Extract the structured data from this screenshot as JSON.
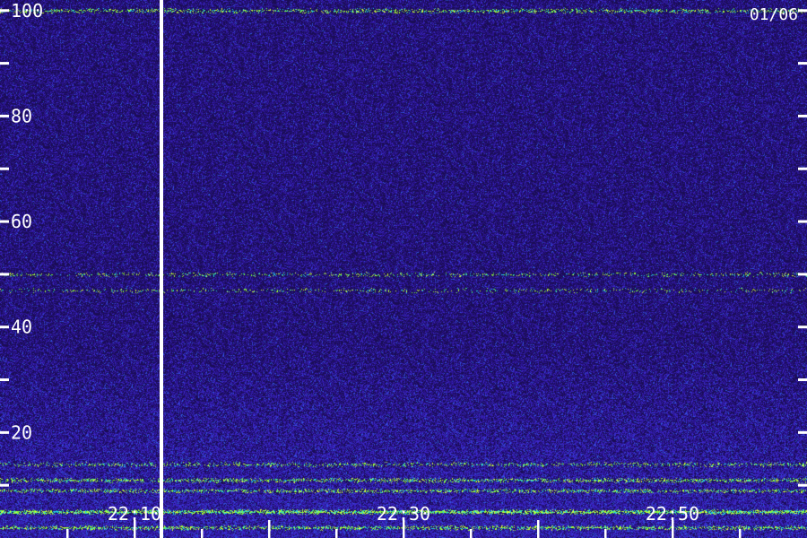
{
  "chart_data": {
    "type": "heatmap",
    "date_label": "01/06",
    "y_ticks": [
      100,
      80,
      60,
      40,
      20
    ],
    "y_minor_ticks": [
      90,
      70,
      50,
      30,
      10
    ],
    "x_tick_labels": [
      "22:10",
      "22:30",
      "22:50"
    ],
    "xlim": [
      "22:00",
      "23:00"
    ],
    "ylim": [
      0,
      102
    ],
    "marker_time": "22:12",
    "background_color": "#1a0d55",
    "noise_colors": [
      "#2a1490",
      "#3a28c8",
      "#2f5be0"
    ],
    "band_colors": [
      "#22d3e6",
      "#7dff3a",
      "#d8ff3a"
    ],
    "bands": [
      {
        "freq": 100,
        "strength": 0.45
      },
      {
        "freq": 50,
        "strength": 0.25
      },
      {
        "freq": 47,
        "strength": 0.2
      },
      {
        "freq": 14,
        "strength": 0.35
      },
      {
        "freq": 11,
        "strength": 0.55
      },
      {
        "freq": 9,
        "strength": 0.5
      },
      {
        "freq": 5,
        "strength": 0.9
      },
      {
        "freq": 2,
        "strength": 0.6
      }
    ]
  }
}
